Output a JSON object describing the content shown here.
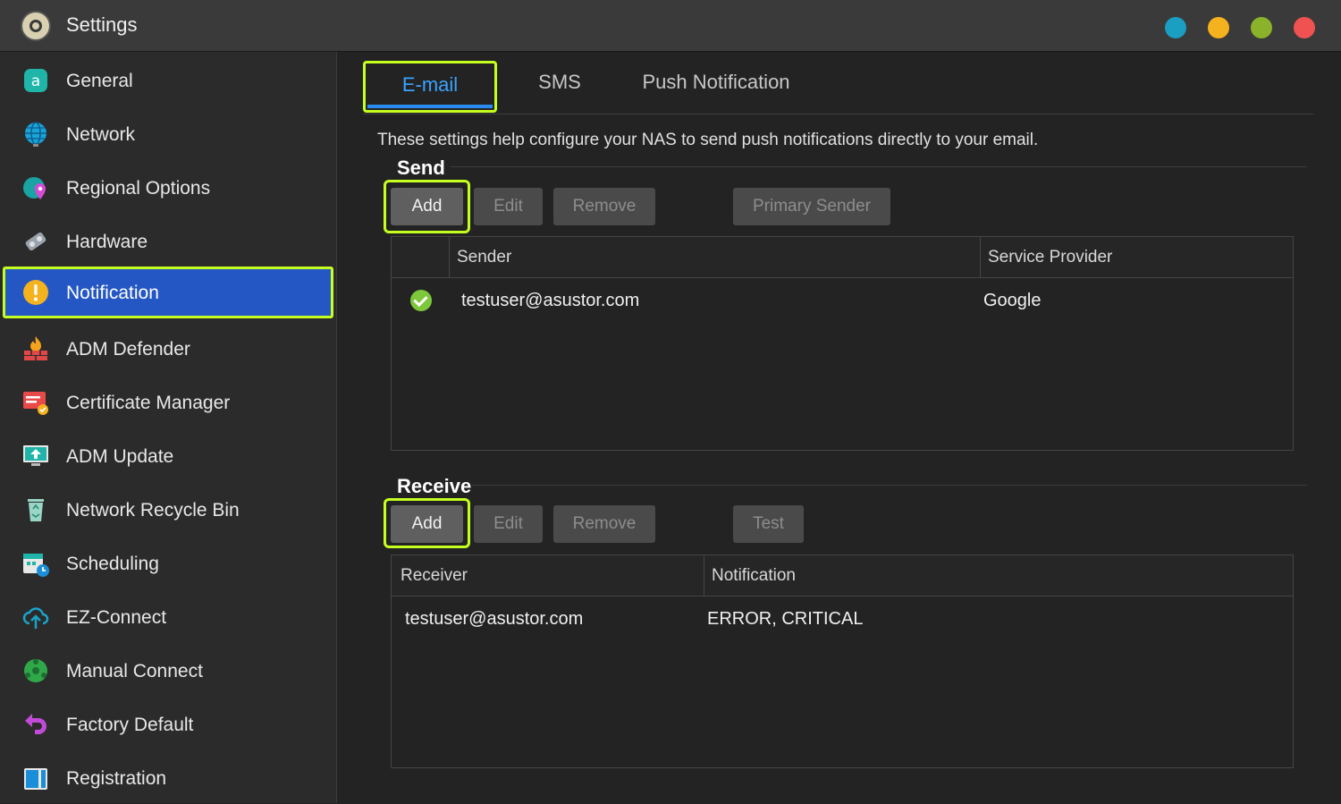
{
  "window": {
    "title": "Settings",
    "controls": [
      {
        "name": "window-blue-button",
        "color": "#1a9ec2"
      },
      {
        "name": "window-minimize-button",
        "color": "#f5b21f"
      },
      {
        "name": "window-maximize-button",
        "color": "#8ab22a"
      },
      {
        "name": "window-close-button",
        "color": "#f05252"
      }
    ]
  },
  "sidebar": {
    "items": [
      {
        "label": "General",
        "icon": "general-icon"
      },
      {
        "label": "Network",
        "icon": "globe-icon"
      },
      {
        "label": "Regional Options",
        "icon": "map-pin-icon"
      },
      {
        "label": "Hardware",
        "icon": "hardware-icon"
      },
      {
        "label": "Notification",
        "icon": "alert-icon",
        "active": true
      },
      {
        "label": "ADM Defender",
        "icon": "firewall-icon"
      },
      {
        "label": "Certificate Manager",
        "icon": "certificate-icon"
      },
      {
        "label": "ADM Update",
        "icon": "update-icon"
      },
      {
        "label": "Network Recycle Bin",
        "icon": "recycle-bin-icon"
      },
      {
        "label": "Scheduling",
        "icon": "calendar-clock-icon"
      },
      {
        "label": "EZ-Connect",
        "icon": "cloud-upload-icon"
      },
      {
        "label": "Manual Connect",
        "icon": "manual-connect-icon"
      },
      {
        "label": "Factory Default",
        "icon": "undo-icon"
      },
      {
        "label": "Registration",
        "icon": "registration-icon"
      }
    ]
  },
  "tabs": [
    {
      "label": "E-mail",
      "active": true
    },
    {
      "label": "SMS"
    },
    {
      "label": "Push Notification"
    }
  ],
  "description": "These settings help configure your NAS to send push notifications directly to your email.",
  "send": {
    "title": "Send",
    "buttons": {
      "add": "Add",
      "edit": "Edit",
      "remove": "Remove",
      "primary": "Primary Sender"
    },
    "columns": {
      "sender": "Sender",
      "provider": "Service Provider"
    },
    "rows": [
      {
        "sender": "testuser@asustor.com",
        "provider": "Google",
        "status": "check-icon"
      }
    ]
  },
  "receive": {
    "title": "Receive",
    "buttons": {
      "add": "Add",
      "edit": "Edit",
      "remove": "Remove",
      "test": "Test"
    },
    "columns": {
      "receiver": "Receiver",
      "notification": "Notification"
    },
    "rows": [
      {
        "receiver": "testuser@asustor.com",
        "notification": "ERROR, CRITICAL"
      }
    ]
  },
  "colors": {
    "accent_highlight": "#c5ff1f",
    "active_item": "#2457c4",
    "tab_active_text": "#3aa3ff"
  }
}
